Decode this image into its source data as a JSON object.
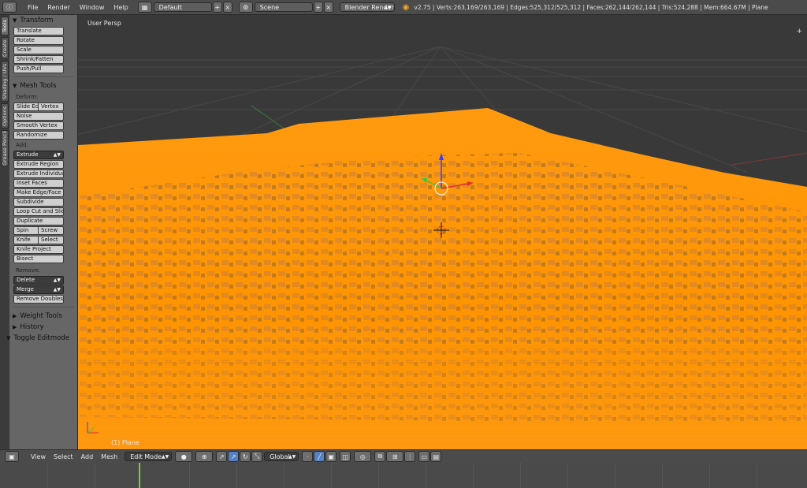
{
  "topbar": {
    "menus": [
      "File",
      "Render",
      "Window",
      "Help"
    ],
    "screen_layout": "Default",
    "scene": "Scene",
    "render_engine": "Blender Render",
    "stats": "v2.75 | Verts:263,169/263,169 | Edges:525,312/525,312 | Faces:262,144/262,144 | Tris:524,288 | Mem:664.67M | Plane"
  },
  "left_tabs": [
    "Tools",
    "Create",
    "Shading / UVs",
    "Options",
    "Grease Pencil"
  ],
  "toolshelf": {
    "transform": {
      "title": "Transform",
      "buttons": [
        "Translate",
        "Rotate",
        "Scale",
        "Shrink/Fatten",
        "Push/Pull"
      ]
    },
    "mesh_tools": {
      "title": "Mesh Tools",
      "deform_label": "Deform:",
      "slide_edge": "Slide Ed",
      "vertex": "Vertex",
      "noise": "Noise",
      "smooth_vertex": "Smooth Vertex",
      "randomize": "Randomize",
      "add_label": "Add:",
      "extrude": "Extrude",
      "extrude_region": "Extrude Region",
      "extrude_individual": "Extrude Individual",
      "inset_faces": "Inset Faces",
      "make_edge_face": "Make Edge/Face",
      "subdivide": "Subdivide",
      "loop_cut": "Loop Cut and Slide",
      "duplicate": "Duplicate",
      "spin": "Spin",
      "screw": "Screw",
      "knife": "Knife",
      "select": "Select",
      "knife_project": "Knife Project",
      "bisect": "Bisect",
      "remove_label": "Remove:",
      "delete": "Delete",
      "merge": "Merge",
      "remove_doubles": "Remove Doubles"
    },
    "weight_tools": "Weight Tools",
    "history": "History",
    "toggle_editmode": "Toggle Editmode"
  },
  "viewport": {
    "view_label": "User Persp",
    "object_label": "(1) Plane",
    "mesh_color": "#ff9400",
    "grid_color": "#454545"
  },
  "bottombar": {
    "menus": [
      "View",
      "Select",
      "Add",
      "Mesh"
    ],
    "mode": "Edit Mode",
    "orientation": "Global"
  },
  "timeline": {
    "cursor_color": "#7ecf3a"
  }
}
